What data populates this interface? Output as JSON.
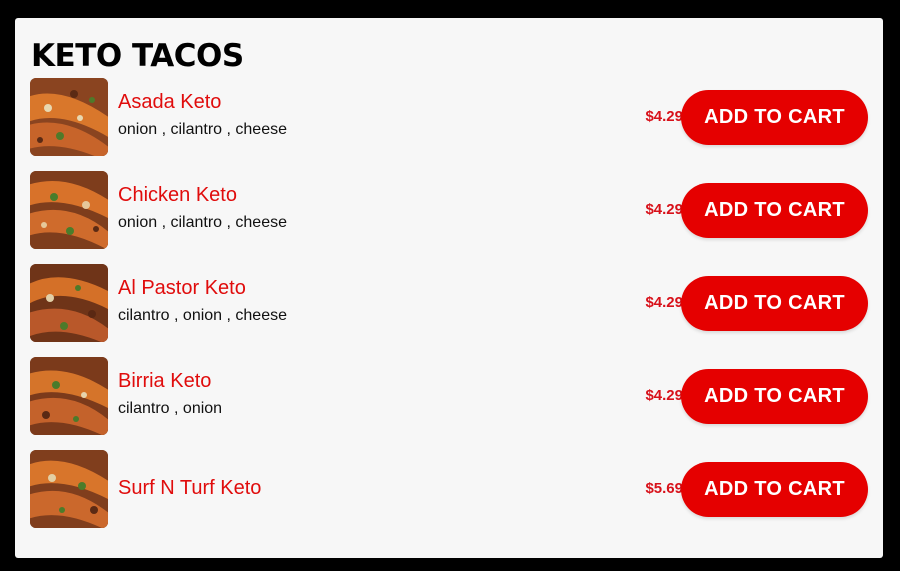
{
  "section": {
    "title": "KETO TACOS"
  },
  "items": [
    {
      "name": "Asada Keto",
      "description": "onion , cilantro , cheese",
      "price": "$4.29",
      "button_label": "ADD TO CART"
    },
    {
      "name": "Chicken Keto",
      "description": "onion , cilantro , cheese",
      "price": "$4.29",
      "button_label": "ADD TO CART"
    },
    {
      "name": "Al Pastor Keto",
      "description": "cilantro , onion , cheese",
      "price": "$4.29",
      "button_label": "ADD TO CART"
    },
    {
      "name": "Birria Keto",
      "description": "cilantro , onion",
      "price": "$4.29",
      "button_label": "ADD TO CART"
    },
    {
      "name": "Surf N Turf Keto",
      "description": "",
      "price": "$5.69",
      "button_label": "ADD TO CART"
    }
  ],
  "colors": {
    "accent": "#e50000",
    "item_name": "#e00c0c",
    "price": "#d8111a",
    "card_background": "#f7f7f7",
    "page_background": "#000000"
  }
}
